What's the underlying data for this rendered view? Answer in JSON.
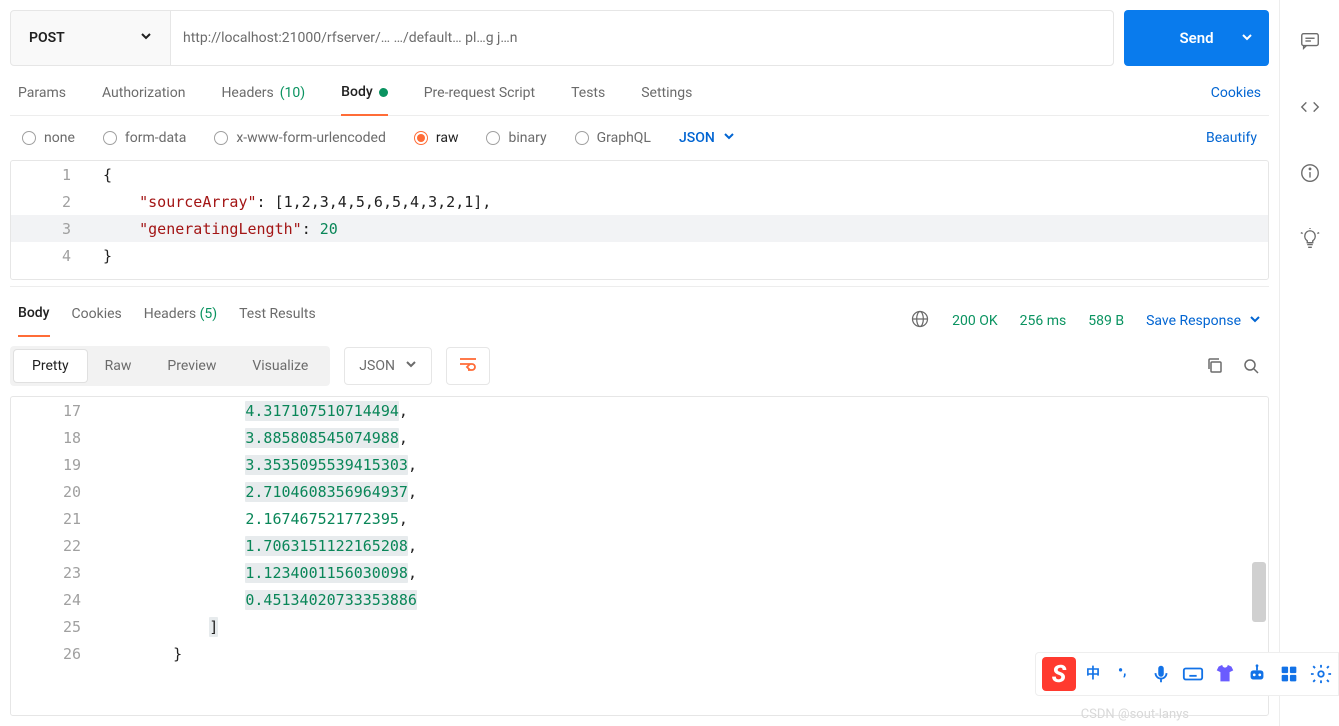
{
  "method": "POST",
  "url": "http://localhost:21000/rfserver/…                                               …/default…    pl…g j…n",
  "send_label": "Send",
  "request_tabs": {
    "params": "Params",
    "auth": "Authorization",
    "headers": "Headers",
    "headers_count": "(10)",
    "body": "Body",
    "prereq": "Pre-request Script",
    "tests": "Tests",
    "settings": "Settings",
    "cookies": "Cookies"
  },
  "body_types": {
    "none": "none",
    "formdata": "form-data",
    "xform": "x-www-form-urlencoded",
    "raw": "raw",
    "binary": "binary",
    "graphql": "GraphQL",
    "fmt": "JSON",
    "beautify": "Beautify"
  },
  "request_body": {
    "l1": "{",
    "l2_key": "\"sourceArray\"",
    "l2_rest": ": [1,2,3,4,5,6,5,4,3,2,1],",
    "l3_key": "\"generatingLength\"",
    "l3_colon": ": ",
    "l3_val": "20",
    "l4": "}"
  },
  "response_tabs": {
    "body": "Body",
    "cookies": "Cookies",
    "headers": "Headers",
    "headers_count": "(5)",
    "testres": "Test Results"
  },
  "status": {
    "code": "200 OK",
    "time": "256 ms",
    "size": "589 B",
    "save": "Save Response"
  },
  "view_tabs": {
    "pretty": "Pretty",
    "raw": "Raw",
    "preview": "Preview",
    "visualize": "Visualize",
    "fmt": "JSON"
  },
  "response_lines": [
    {
      "ln": "17",
      "indent": "            ",
      "val": "4.317107510714494",
      "comma": true,
      "hl": true
    },
    {
      "ln": "18",
      "indent": "            ",
      "val": "3.885808545074988",
      "comma": true,
      "hl": true
    },
    {
      "ln": "19",
      "indent": "            ",
      "val": "3.3535095539415303",
      "comma": true,
      "hl": true
    },
    {
      "ln": "20",
      "indent": "            ",
      "val": "2.7104608356964937",
      "comma": true,
      "hl": true
    },
    {
      "ln": "21",
      "indent": "            ",
      "val": "2.167467521772395",
      "comma": true,
      "hl": false
    },
    {
      "ln": "22",
      "indent": "            ",
      "val": "1.7063151122165208",
      "comma": true,
      "hl": true
    },
    {
      "ln": "23",
      "indent": "            ",
      "val": "1.1234001156030098",
      "comma": true,
      "hl": true
    },
    {
      "ln": "24",
      "indent": "            ",
      "val": "0.45134020733353886",
      "comma": false,
      "hl": true
    },
    {
      "ln": "25",
      "indent": "        ",
      "val": "]",
      "pun": true,
      "hl": true
    },
    {
      "ln": "26",
      "indent": "    ",
      "val": "}",
      "pun": true,
      "hl": false
    }
  ],
  "watermark": "CSDN @sout-lanys",
  "ime_s": "S",
  "ime_zh": "中"
}
